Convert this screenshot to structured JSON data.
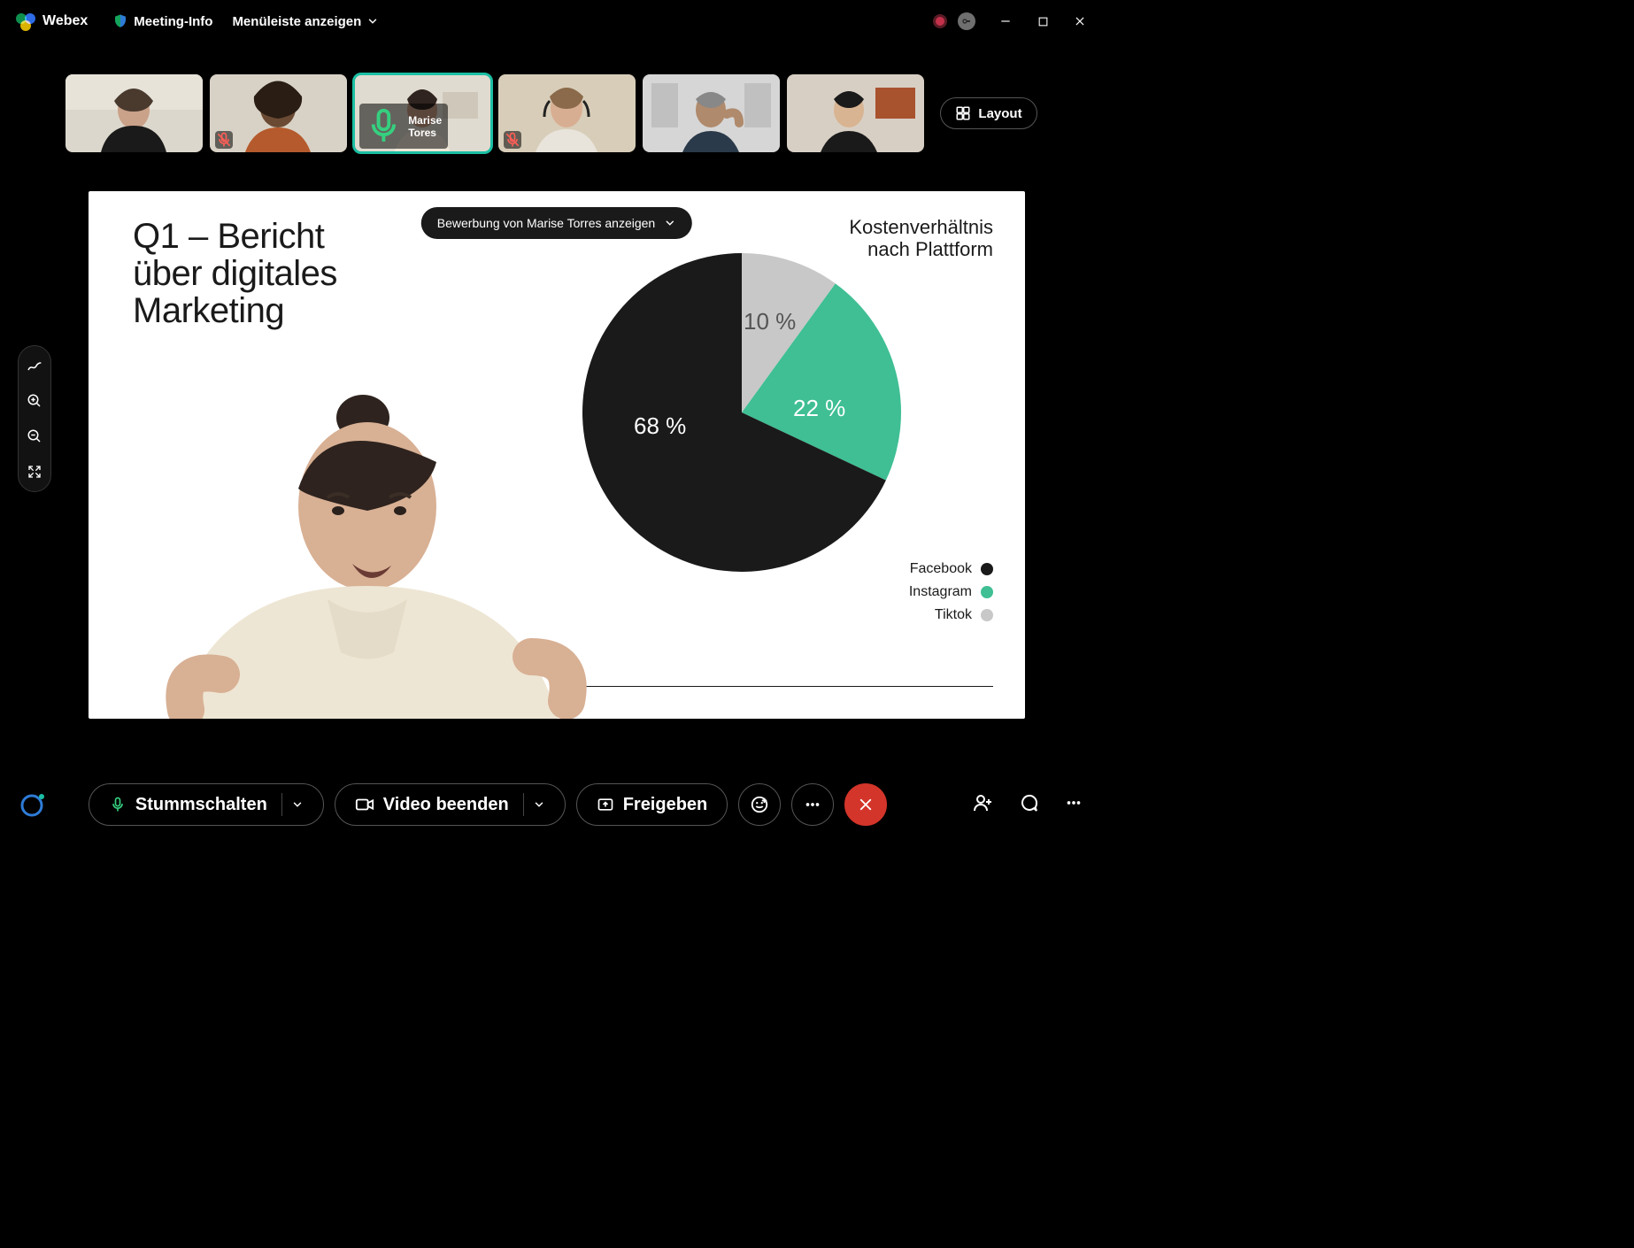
{
  "app": {
    "name": "Webex"
  },
  "topbar": {
    "meeting_info": "Meeting-Info",
    "menu_toggle": "Menüleiste anzeigen"
  },
  "filmstrip": {
    "active_speaker": "Marise Tores",
    "active_index": 2,
    "muted_indices": [
      1,
      3
    ],
    "layout_button": "Layout",
    "count": 6
  },
  "stage": {
    "share_pill": "Bewerbung von Marise Torres anzeigen",
    "title_line1": "Q1 – Bericht",
    "title_line2": "über digitales",
    "title_line3": "Marketing",
    "chart_title_line1": "Kostenverhältnis",
    "chart_title_line2": "nach Plattform"
  },
  "chart_data": {
    "type": "pie",
    "title": "Kostenverhältnis nach Plattform",
    "series": [
      {
        "name": "Facebook",
        "value": 68,
        "label": "68 %",
        "color": "#1a1a1a"
      },
      {
        "name": "Instagram",
        "value": 22,
        "label": "22 %",
        "color": "#3fbf93"
      },
      {
        "name": "Tiktok",
        "value": 10,
        "label": "10 %",
        "color": "#c8c8c8"
      }
    ]
  },
  "controls": {
    "mute": "Stummschalten",
    "video": "Video beenden",
    "share": "Freigeben"
  }
}
